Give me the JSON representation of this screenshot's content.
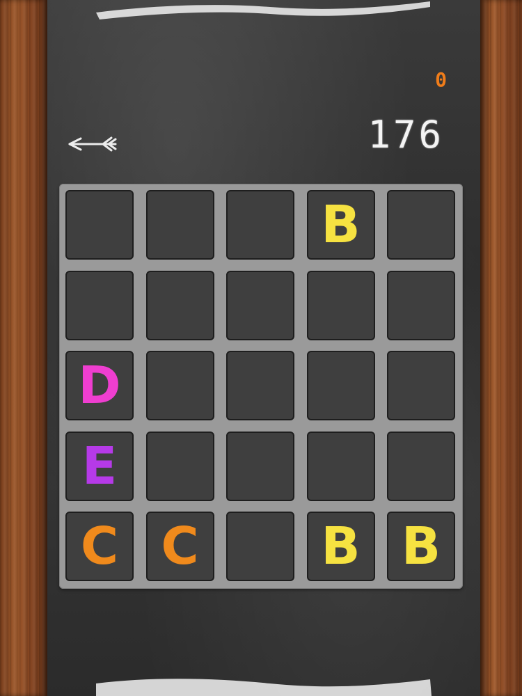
{
  "header": {
    "secondary_score": "0",
    "primary_score": "176"
  },
  "colors": {
    "B": "#f6e241",
    "C": "#f08a1c",
    "D": "#ef3ed0",
    "E": "#b63ae8",
    "secondary_score": "#f07d1a"
  },
  "board": {
    "rows": 5,
    "cols": 5,
    "cells": [
      [
        "",
        "",
        "",
        "B",
        ""
      ],
      [
        "",
        "",
        "",
        "",
        ""
      ],
      [
        "D",
        "",
        "",
        "",
        ""
      ],
      [
        "E",
        "",
        "",
        "",
        ""
      ],
      [
        "C",
        "C",
        "",
        "B",
        "B"
      ]
    ]
  },
  "icons": {
    "back": "back-arrow-icon"
  }
}
